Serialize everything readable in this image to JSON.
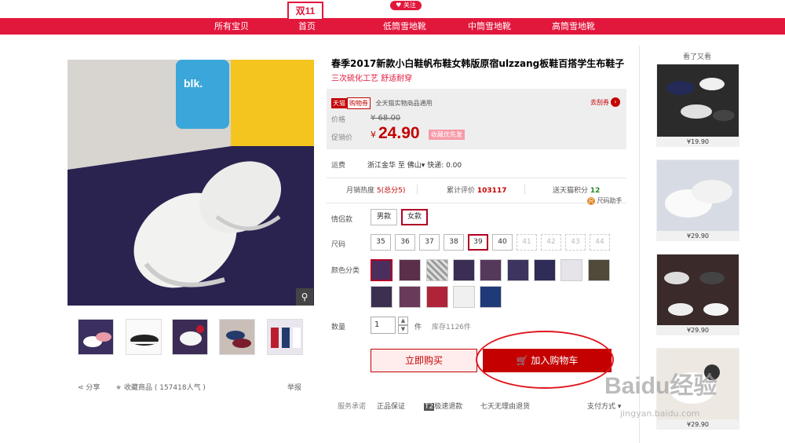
{
  "header": {
    "logo_text": "双11",
    "follow_label": "关注",
    "nav": [
      "所有宝贝",
      "首页",
      "低筒雪地靴",
      "中筒雪地靴",
      "高筒雪地靴"
    ]
  },
  "product": {
    "title": "春季2017新款小白鞋帆布鞋女韩版原宿ulzzang板鞋百搭学生布鞋子",
    "subtitle": "三次硫化工艺 舒适耐穿",
    "tmall_badge": "天猫",
    "coupon_badge": "购物券",
    "coupon_text": "全天猫实物商品通用",
    "coupon_link": "去刮券",
    "price_label": "价格",
    "original_price": "¥ 68.00",
    "promo_label": "促销价",
    "currency": "¥",
    "promo_price": "24.90",
    "promo_tag": "收藏优先发",
    "shipping_label": "运费",
    "shipping_from": "浙江金华",
    "shipping_to_word": "至",
    "shipping_to": "佛山",
    "shipping_fee": "快递: 0.00",
    "monthly_sales_label": "月销热度",
    "monthly_sales_value": "5(总分5)",
    "reviews_label": "累计评价",
    "reviews_value": "103117",
    "points_label": "送天猫积分",
    "points_value": "12",
    "size_helper": "尺码助手",
    "couple_label": "情侣款",
    "couple_options": [
      "男款",
      "女款"
    ],
    "size_label": "尺码",
    "sizes": [
      "35",
      "36",
      "37",
      "38",
      "39",
      "40",
      "41",
      "42",
      "43",
      "44"
    ],
    "color_label": "颜色分类",
    "qty_label": "数量",
    "qty_value": "1",
    "qty_unit": "件",
    "stock": "库存1126件",
    "buy_now": "立即购买",
    "add_to_cart": "加入购物车",
    "service_label": "服务承诺",
    "service_items": [
      "正品保证",
      "极速退款",
      "七天无理由退货"
    ],
    "service_t2": "T2",
    "payment": "支付方式",
    "share": "分享",
    "favorite": "收藏商品",
    "favorite_count": "( 157418人气 )",
    "report": "举报",
    "zoom_icon": "magnifier-icon"
  },
  "sidebar": {
    "title": "看了又看",
    "prices": [
      "¥19.90",
      "¥29.90",
      "¥29.90",
      "¥29.90"
    ]
  },
  "watermark": {
    "text": "Baidu经验",
    "sub": "jingyan.baidu.com"
  },
  "colors": {
    "brand": "#e2173c",
    "price": "#c40000"
  }
}
